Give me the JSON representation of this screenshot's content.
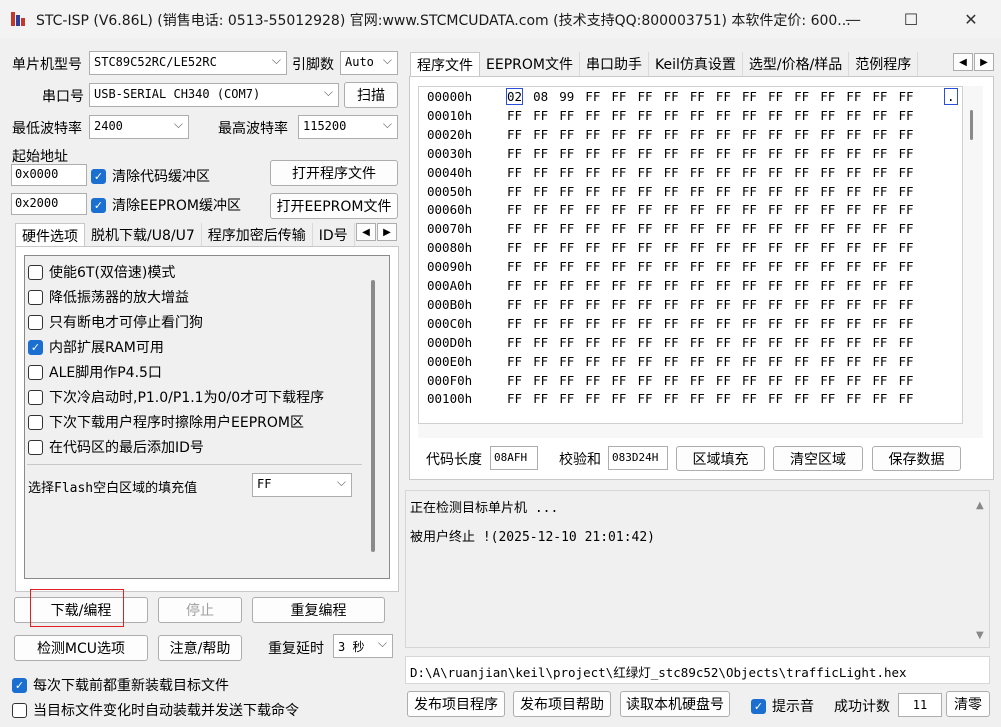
{
  "window": {
    "title": "STC-ISP (V6.86L) (销售电话: 0513-55012928) 官网:www.STCMCUDATA.com  (技术支持QQ:800003751) 本软件定价: 600...",
    "minimize": "—",
    "maximize": "☐",
    "close": "✕"
  },
  "left": {
    "mcu_label": "单片机型号",
    "mcu_value": "STC89C52RC/LE52RC",
    "pins_label": "引脚数",
    "pins_value": "Auto",
    "port_label": "串口号",
    "port_value": "USB-SERIAL CH340 (COM7)",
    "scan_button": "扫描",
    "min_baud_label": "最低波特率",
    "min_baud_value": "2400",
    "max_baud_label": "最高波特率",
    "max_baud_value": "115200",
    "start_addr_label": "起始地址",
    "addr1": "0x0000",
    "clear_code_label": "清除代码缓冲区",
    "open_program_button": "打开程序文件",
    "addr2": "0x2000",
    "clear_eeprom_label": "清除EEPROM缓冲区",
    "open_eeprom_button": "打开EEPROM文件",
    "tabs": [
      "硬件选项",
      "脱机下载/U8/U7",
      "程序加密后传输",
      "ID号"
    ],
    "options": [
      {
        "label": "使能6T(双倍速)模式",
        "checked": false
      },
      {
        "label": "降低振荡器的放大增益",
        "checked": false
      },
      {
        "label": "只有断电才可停止看门狗",
        "checked": false
      },
      {
        "label": "内部扩展RAM可用",
        "checked": true
      },
      {
        "label": "ALE脚用作P4.5口",
        "checked": false
      },
      {
        "label": "下次冷启动时,P1.0/P1.1为0/0才可下载程序",
        "checked": false
      },
      {
        "label": "下次下载用户程序时擦除用户EEPROM区",
        "checked": false
      },
      {
        "label": "在代码区的最后添加ID号",
        "checked": false
      }
    ],
    "fill_label": "选择Flash空白区域的填充值",
    "fill_value": "FF",
    "download_button": "下载/编程",
    "stop_button": "停止",
    "reprogram_button": "重复编程",
    "detect_button": "检测MCU选项",
    "help_button": "注意/帮助",
    "repeat_delay_label": "重复延时",
    "repeat_delay_value": "3 秒",
    "reload_label": "每次下载前都重新装载目标文件",
    "auto_label": "当目标文件变化时自动装载并发送下载命令"
  },
  "right": {
    "tabs": [
      "程序文件",
      "EEPROM文件",
      "串口助手",
      "Keil仿真设置",
      "选型/价格/样品",
      "范例程序"
    ],
    "hex_rows": [
      {
        "addr": "00000h",
        "bytes": [
          "02",
          "08",
          "99",
          "FF",
          "FF",
          "FF",
          "FF",
          "FF",
          "FF",
          "FF",
          "FF",
          "FF",
          "FF",
          "FF",
          "FF",
          "FF"
        ],
        "ascii": "."
      },
      {
        "addr": "00010h",
        "bytes": [
          "FF",
          "FF",
          "FF",
          "FF",
          "FF",
          "FF",
          "FF",
          "FF",
          "FF",
          "FF",
          "FF",
          "FF",
          "FF",
          "FF",
          "FF",
          "FF"
        ]
      },
      {
        "addr": "00020h",
        "bytes": [
          "FF",
          "FF",
          "FF",
          "FF",
          "FF",
          "FF",
          "FF",
          "FF",
          "FF",
          "FF",
          "FF",
          "FF",
          "FF",
          "FF",
          "FF",
          "FF"
        ]
      },
      {
        "addr": "00030h",
        "bytes": [
          "FF",
          "FF",
          "FF",
          "FF",
          "FF",
          "FF",
          "FF",
          "FF",
          "FF",
          "FF",
          "FF",
          "FF",
          "FF",
          "FF",
          "FF",
          "FF"
        ]
      },
      {
        "addr": "00040h",
        "bytes": [
          "FF",
          "FF",
          "FF",
          "FF",
          "FF",
          "FF",
          "FF",
          "FF",
          "FF",
          "FF",
          "FF",
          "FF",
          "FF",
          "FF",
          "FF",
          "FF"
        ]
      },
      {
        "addr": "00050h",
        "bytes": [
          "FF",
          "FF",
          "FF",
          "FF",
          "FF",
          "FF",
          "FF",
          "FF",
          "FF",
          "FF",
          "FF",
          "FF",
          "FF",
          "FF",
          "FF",
          "FF"
        ]
      },
      {
        "addr": "00060h",
        "bytes": [
          "FF",
          "FF",
          "FF",
          "FF",
          "FF",
          "FF",
          "FF",
          "FF",
          "FF",
          "FF",
          "FF",
          "FF",
          "FF",
          "FF",
          "FF",
          "FF"
        ]
      },
      {
        "addr": "00070h",
        "bytes": [
          "FF",
          "FF",
          "FF",
          "FF",
          "FF",
          "FF",
          "FF",
          "FF",
          "FF",
          "FF",
          "FF",
          "FF",
          "FF",
          "FF",
          "FF",
          "FF"
        ]
      },
      {
        "addr": "00080h",
        "bytes": [
          "FF",
          "FF",
          "FF",
          "FF",
          "FF",
          "FF",
          "FF",
          "FF",
          "FF",
          "FF",
          "FF",
          "FF",
          "FF",
          "FF",
          "FF",
          "FF"
        ]
      },
      {
        "addr": "00090h",
        "bytes": [
          "FF",
          "FF",
          "FF",
          "FF",
          "FF",
          "FF",
          "FF",
          "FF",
          "FF",
          "FF",
          "FF",
          "FF",
          "FF",
          "FF",
          "FF",
          "FF"
        ]
      },
      {
        "addr": "000A0h",
        "bytes": [
          "FF",
          "FF",
          "FF",
          "FF",
          "FF",
          "FF",
          "FF",
          "FF",
          "FF",
          "FF",
          "FF",
          "FF",
          "FF",
          "FF",
          "FF",
          "FF"
        ]
      },
      {
        "addr": "000B0h",
        "bytes": [
          "FF",
          "FF",
          "FF",
          "FF",
          "FF",
          "FF",
          "FF",
          "FF",
          "FF",
          "FF",
          "FF",
          "FF",
          "FF",
          "FF",
          "FF",
          "FF"
        ]
      },
      {
        "addr": "000C0h",
        "bytes": [
          "FF",
          "FF",
          "FF",
          "FF",
          "FF",
          "FF",
          "FF",
          "FF",
          "FF",
          "FF",
          "FF",
          "FF",
          "FF",
          "FF",
          "FF",
          "FF"
        ]
      },
      {
        "addr": "000D0h",
        "bytes": [
          "FF",
          "FF",
          "FF",
          "FF",
          "FF",
          "FF",
          "FF",
          "FF",
          "FF",
          "FF",
          "FF",
          "FF",
          "FF",
          "FF",
          "FF",
          "FF"
        ]
      },
      {
        "addr": "000E0h",
        "bytes": [
          "FF",
          "FF",
          "FF",
          "FF",
          "FF",
          "FF",
          "FF",
          "FF",
          "FF",
          "FF",
          "FF",
          "FF",
          "FF",
          "FF",
          "FF",
          "FF"
        ]
      },
      {
        "addr": "000F0h",
        "bytes": [
          "FF",
          "FF",
          "FF",
          "FF",
          "FF",
          "FF",
          "FF",
          "FF",
          "FF",
          "FF",
          "FF",
          "FF",
          "FF",
          "FF",
          "FF",
          "FF"
        ]
      },
      {
        "addr": "00100h",
        "bytes": [
          "FF",
          "FF",
          "FF",
          "FF",
          "FF",
          "FF",
          "FF",
          "FF",
          "FF",
          "FF",
          "FF",
          "FF",
          "FF",
          "FF",
          "FF",
          "FF"
        ]
      }
    ],
    "code_len_label": "代码长度",
    "code_len_value": "08AFH",
    "checksum_label": "校验和",
    "checksum_value": "083D24H",
    "fill_area_button": "区域填充",
    "clear_area_button": "清空区域",
    "save_data_button": "保存数据",
    "log_line1": "正在检测目标单片机 ...",
    "log_line2": "被用户终止 !(2025-12-10 21:01:42)",
    "file_path": "D:\\A\\ruanjian\\keil\\project\\红绿灯_stc89c52\\Objects\\trafficLight.hex",
    "publish_program_button": "发布项目程序",
    "publish_help_button": "发布项目帮助",
    "read_disk_button": "读取本机硬盘号",
    "sound_label": "提示音",
    "success_label": "成功计数",
    "success_value": "11",
    "reset_button": "清零"
  }
}
